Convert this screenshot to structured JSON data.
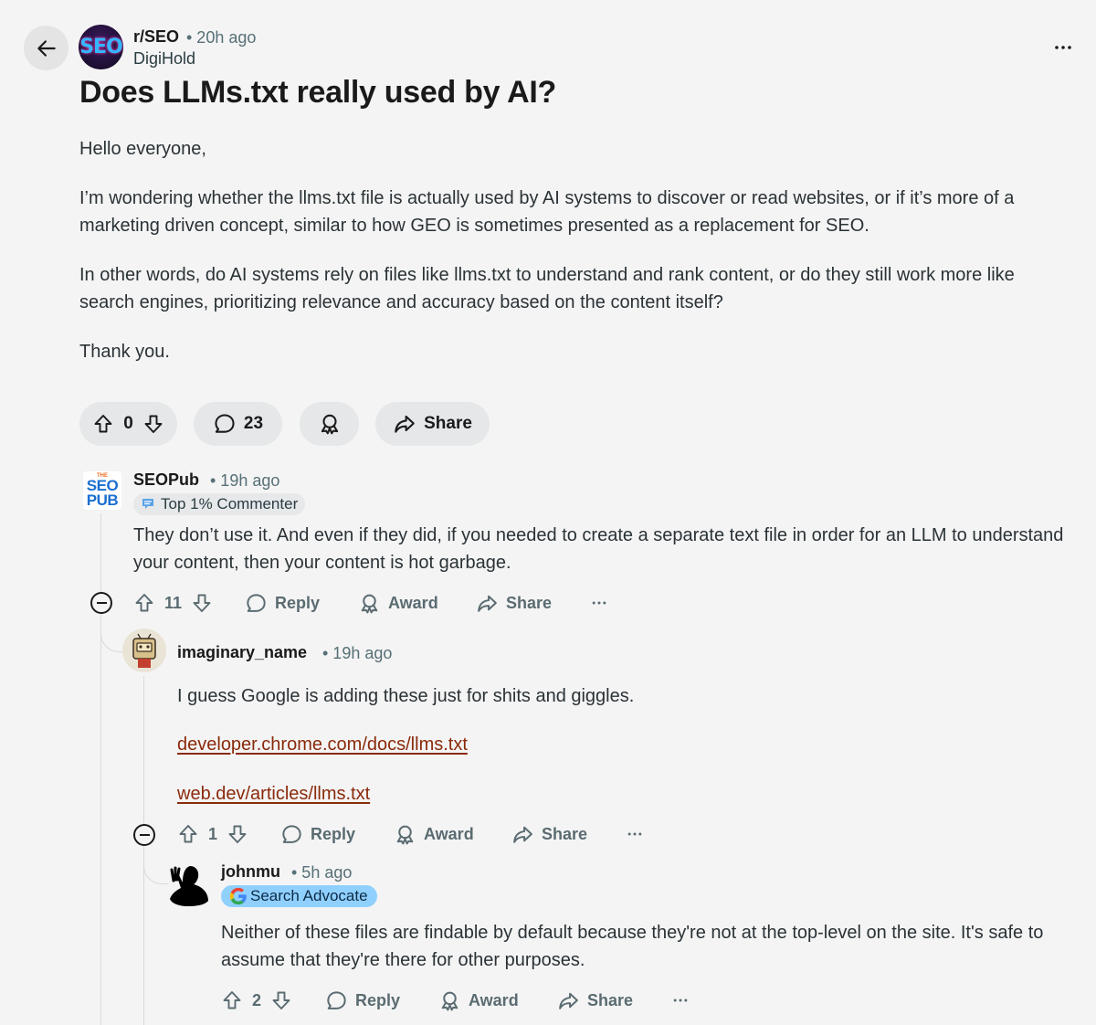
{
  "post": {
    "subreddit": "r/SEO",
    "time": "• 20h ago",
    "author": "DigiHold",
    "subreddit_avatar_text": "SEO",
    "title": "Does LLMs.txt really used by AI?",
    "paragraphs": [
      "Hello everyone,",
      "I’m wondering whether the llms.txt file is actually used by AI systems to discover or read websites, or if it’s more of a marketing driven concept, similar to how GEO is sometimes presented as a replacement for SEO.",
      "In other words, do AI systems rely on files like llms.txt to understand and rank content, or do they still work more like search engines, prioritizing relevance and accuracy based on the content itself?",
      "Thank you."
    ],
    "votes": "0",
    "comments": "23",
    "share_label": "Share"
  },
  "comments": [
    {
      "author": "SEOPub",
      "time": "• 19h ago",
      "flair": "Top 1% Commenter",
      "avatar_text": [
        "THE",
        "SEO",
        "PUB"
      ],
      "text": "They don’t use it. And even if they did, if you needed to create a separate text file in order for an LLM to understand your content, then your content is hot garbage.",
      "votes": "11",
      "reply": "Reply",
      "award": "Award",
      "share": "Share"
    },
    {
      "author": "imaginary_name",
      "time": "• 19h ago",
      "text": "I guess Google is adding these just for shits and giggles.",
      "links": [
        "developer.chrome.com/docs/llms.txt",
        "web.dev/articles/llms.txt"
      ],
      "votes": "1",
      "reply": "Reply",
      "award": "Award",
      "share": "Share"
    },
    {
      "author": "johnmu",
      "time": "• 5h ago",
      "flair": "Search Advocate",
      "text": "Neither of these files are findable by default because they're not at the top-level on the site. It's safe to assume that they're there for other purposes.",
      "votes": "2",
      "reply": "Reply",
      "award": "Award",
      "share": "Share"
    }
  ],
  "colors": {
    "background": "#f4f4f4",
    "link": "#8a2a0b",
    "pill": "#e5e7e8",
    "search_advocate_flair": "#8fd0ff"
  }
}
